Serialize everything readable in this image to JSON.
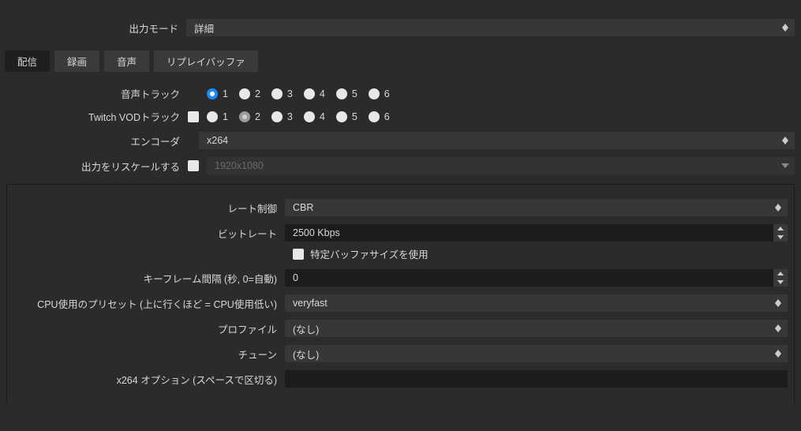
{
  "outputMode": {
    "label": "出力モード",
    "value": "詳細"
  },
  "tabs": {
    "stream": "配信",
    "record": "録画",
    "audio": "音声",
    "replay": "リプレイバッファ"
  },
  "audioTrack": {
    "label": "音声トラック",
    "options": [
      "1",
      "2",
      "3",
      "4",
      "5",
      "6"
    ]
  },
  "twitchVod": {
    "label": "Twitch VODトラック",
    "options": [
      "1",
      "2",
      "3",
      "4",
      "5",
      "6"
    ]
  },
  "encoder": {
    "label": "エンコーダ",
    "value": "x264"
  },
  "rescale": {
    "label": "出力をリスケールする",
    "placeholder": "1920x1080"
  },
  "rateControl": {
    "label": "レート制御",
    "value": "CBR"
  },
  "bitrate": {
    "label": "ビットレート",
    "value": "2500 Kbps"
  },
  "bufferCheck": {
    "label": "特定バッファサイズを使用"
  },
  "keyframe": {
    "label": "キーフレーム間隔 (秒, 0=自動)",
    "value": "0"
  },
  "cpuPreset": {
    "label": "CPU使用のプリセット (上に行くほど = CPU使用低い)",
    "value": "veryfast"
  },
  "profile": {
    "label": "プロファイル",
    "value": "(なし)"
  },
  "tune": {
    "label": "チューン",
    "value": "(なし)"
  },
  "x264opts": {
    "label": "x264 オプション (スペースで区切る)",
    "value": ""
  }
}
